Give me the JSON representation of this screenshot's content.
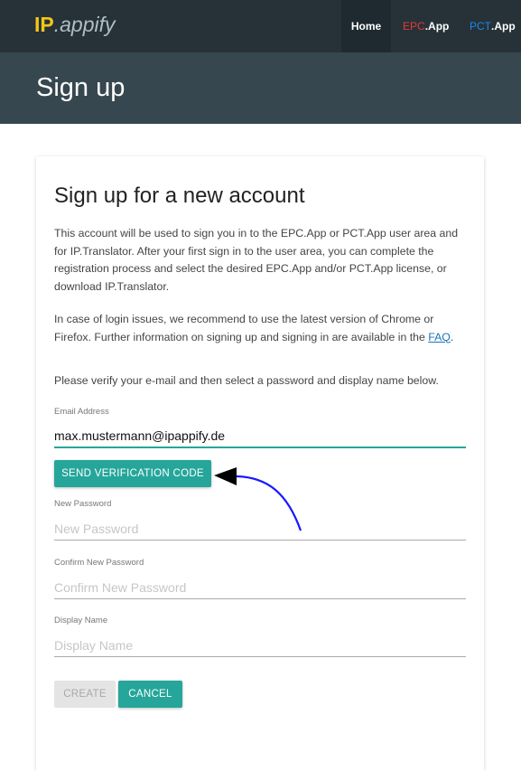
{
  "navbar": {
    "logo_ip": "IP",
    "logo_appify": ".appify",
    "home": "Home",
    "epc_prefix": "EPC",
    "epc_suffix": ".App",
    "pct_prefix": "PCT",
    "pct_suffix": ".App"
  },
  "header": {
    "title": "Sign up"
  },
  "card": {
    "title": "Sign up for a new account",
    "intro": "This account will be used to sign you in to the EPC.App or PCT.App user area and for IP.Translator. After your first sign in to the user area, you can complete the registration process and select the desired EPC.App and/or PCT.App license, or download IP.Translator.",
    "login_issues": "In case of login issues, we recommend to use the latest version of Chrome or Firefox. Further information on signing up and signing in are available in the ",
    "faq_link": "FAQ",
    "login_issues_end": ".",
    "verify_text": "Please verify your e-mail and then select a password and display name below."
  },
  "form": {
    "email_label": "Email Address",
    "email_value": "max.mustermann@ipappify.de",
    "send_button": "SEND VERIFICATION CODE",
    "new_password_label": "New Password",
    "new_password_placeholder": "New Password",
    "confirm_password_label": "Confirm New Password",
    "confirm_password_placeholder": "Confirm New Password",
    "display_name_label": "Display Name",
    "display_name_placeholder": "Display Name",
    "create_button": "CREATE",
    "cancel_button": "CANCEL"
  },
  "colors": {
    "navbar_bg": "#263238",
    "header_bg": "#37474f",
    "accent": "#26a69a",
    "logo_ip": "#f5c518",
    "epc_red": "#e53935",
    "pct_blue": "#1e88e5",
    "annotation_arrow": "#1a1aff"
  }
}
